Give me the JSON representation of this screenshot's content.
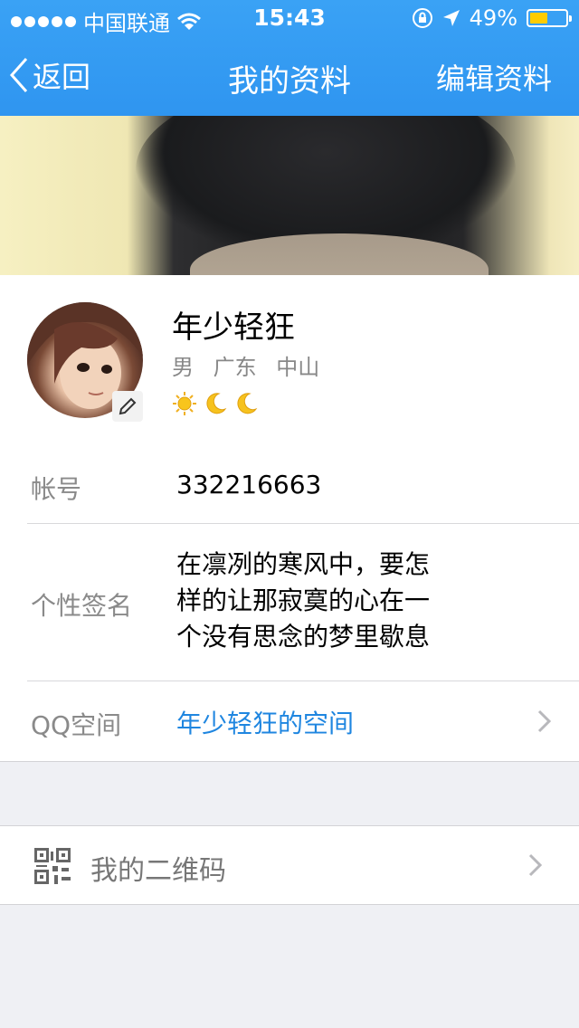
{
  "status_bar": {
    "carrier": "中国联通",
    "time": "15:43",
    "battery": "49%",
    "battery_level": 0.49
  },
  "nav": {
    "back_label": "返回",
    "title": "我的资料",
    "edit_label": "编辑资料"
  },
  "profile": {
    "nickname": "年少轻狂",
    "gender": "男",
    "province": "广东",
    "city": "中山",
    "level_icons": [
      "sun-icon",
      "moon-icon",
      "moon-icon"
    ]
  },
  "info": {
    "account_label": "帐号",
    "account_value": "332216663",
    "signature_label": "个性签名",
    "signature_lines": [
      "在凛冽的寒风中，要怎",
      "样的让那寂寞的心在一",
      "个没有思念的梦里歇息"
    ],
    "qzone_label": "QQ空间",
    "qzone_value": "年少轻狂的空间"
  },
  "qrcode": {
    "label": "我的二维码"
  },
  "colors": {
    "header": "#3aa2f5",
    "link": "#1f86e0",
    "battery": "#ffcc00",
    "background": "#eff0f4"
  }
}
